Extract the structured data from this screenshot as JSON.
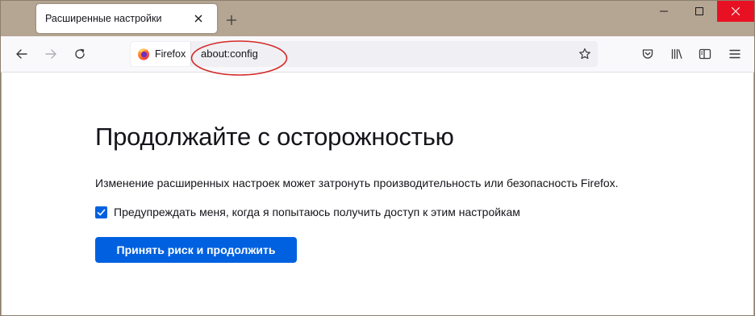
{
  "tab": {
    "title": "Расширенные настройки"
  },
  "urlbar": {
    "identity_label": "Firefox",
    "url": "about:config"
  },
  "page": {
    "title": "Продолжайте с осторожностью",
    "description": "Изменение расширенных настроек может затронуть производительность или безопасность Firefox.",
    "warning_checkbox_label": "Предупреждать меня, когда я попытаюсь получить доступ к этим настройкам",
    "warning_checkbox_checked": true,
    "accept_button_label": "Принять риск и продолжить"
  },
  "icons": {
    "back": "arrow-left-icon",
    "forward": "arrow-right-icon",
    "reload": "reload-icon",
    "bookmark": "star-icon",
    "pocket": "pocket-icon",
    "library": "library-icon",
    "sidebar": "sidebar-icon",
    "menu": "hamburger-menu-icon"
  },
  "colors": {
    "accent": "#0061e0",
    "frame": "#b5a593",
    "close_button": "#e81123",
    "annotation": "#d42a2a"
  }
}
